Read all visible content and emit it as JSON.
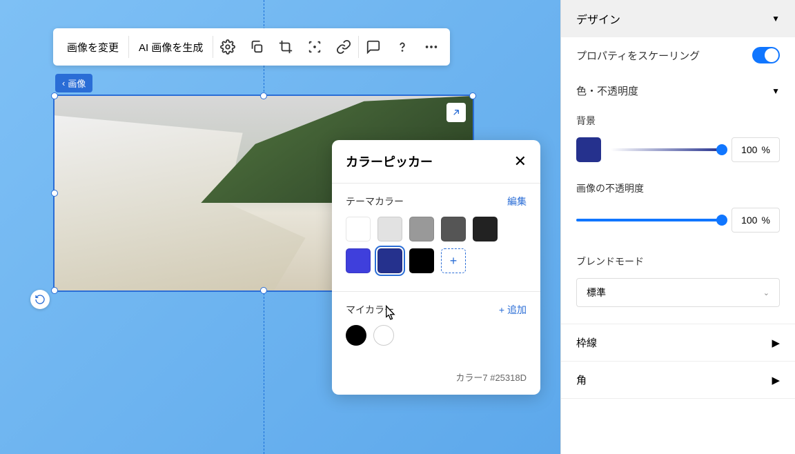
{
  "toolbar": {
    "change_image": "画像を変更",
    "ai_image": "AI 画像を生成"
  },
  "breadcrumb": {
    "label": "画像"
  },
  "color_picker": {
    "title": "カラーピッカー",
    "theme_label": "テーマカラー",
    "edit": "編集",
    "my_label": "マイカラー",
    "add": "+ 追加",
    "theme_colors": [
      "#ffffff",
      "#e2e2e2",
      "#999999",
      "#555555",
      "#222222",
      "#3f3fdc",
      "#25318d",
      "#000000"
    ],
    "my_colors": [
      "#000000",
      "#ffffff"
    ],
    "footer": "カラー7 #25318D"
  },
  "panel": {
    "header": "デザイン",
    "scale_properties": "プロパティをスケーリング",
    "color_opacity": "色・不透明度",
    "background": "背景",
    "bg_color": "#25318d",
    "bg_opacity": "100",
    "pct_symbol": "%",
    "image_opacity": "画像の不透明度",
    "img_opacity": "100",
    "blend_mode": "ブレンドモード",
    "blend_value": "標準",
    "border": "枠線",
    "corner": "角"
  }
}
